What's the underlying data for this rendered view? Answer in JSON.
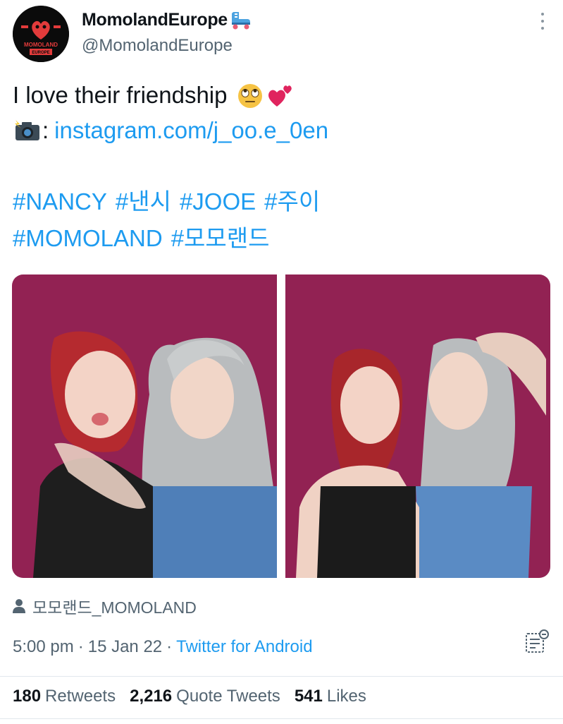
{
  "author": {
    "display_name": "MomolandEurope",
    "handle": "@MomolandEurope",
    "avatar_text_top": "MOMOLAND",
    "avatar_text_bottom": "EUROPE",
    "name_emoji": "roller-skate-emoji"
  },
  "tweet": {
    "line1": "I love their friendship",
    "line1_emojis": [
      "face-with-rolling-eyes-emoji",
      "two-hearts-emoji"
    ],
    "line2_prefix": ":",
    "line2_icon": "camera-with-flash-emoji",
    "link": "instagram.com/j_oo.e_0en",
    "hashtags_row1": [
      "#NANCY",
      "#낸시",
      "#JOOE",
      "#주이"
    ],
    "hashtags_row2": [
      "#MOMOLAND",
      "#모모랜드"
    ]
  },
  "media": {
    "tagged_user": "모모랜드_MOMOLAND",
    "photo_count": 2
  },
  "meta": {
    "time": "5:00 pm",
    "separator": "·",
    "date": "15 Jan 22",
    "source": "Twitter for Android"
  },
  "stats": {
    "retweets_count": "180",
    "retweets_label": "Retweets",
    "quotes_count": "2,216",
    "quotes_label": "Quote Tweets",
    "likes_count": "541",
    "likes_label": "Likes"
  },
  "colors": {
    "link": "#1d9bf0",
    "secondary_text": "#536471",
    "primary_text": "#0f1419",
    "photo_background": "#8a1f4f"
  }
}
